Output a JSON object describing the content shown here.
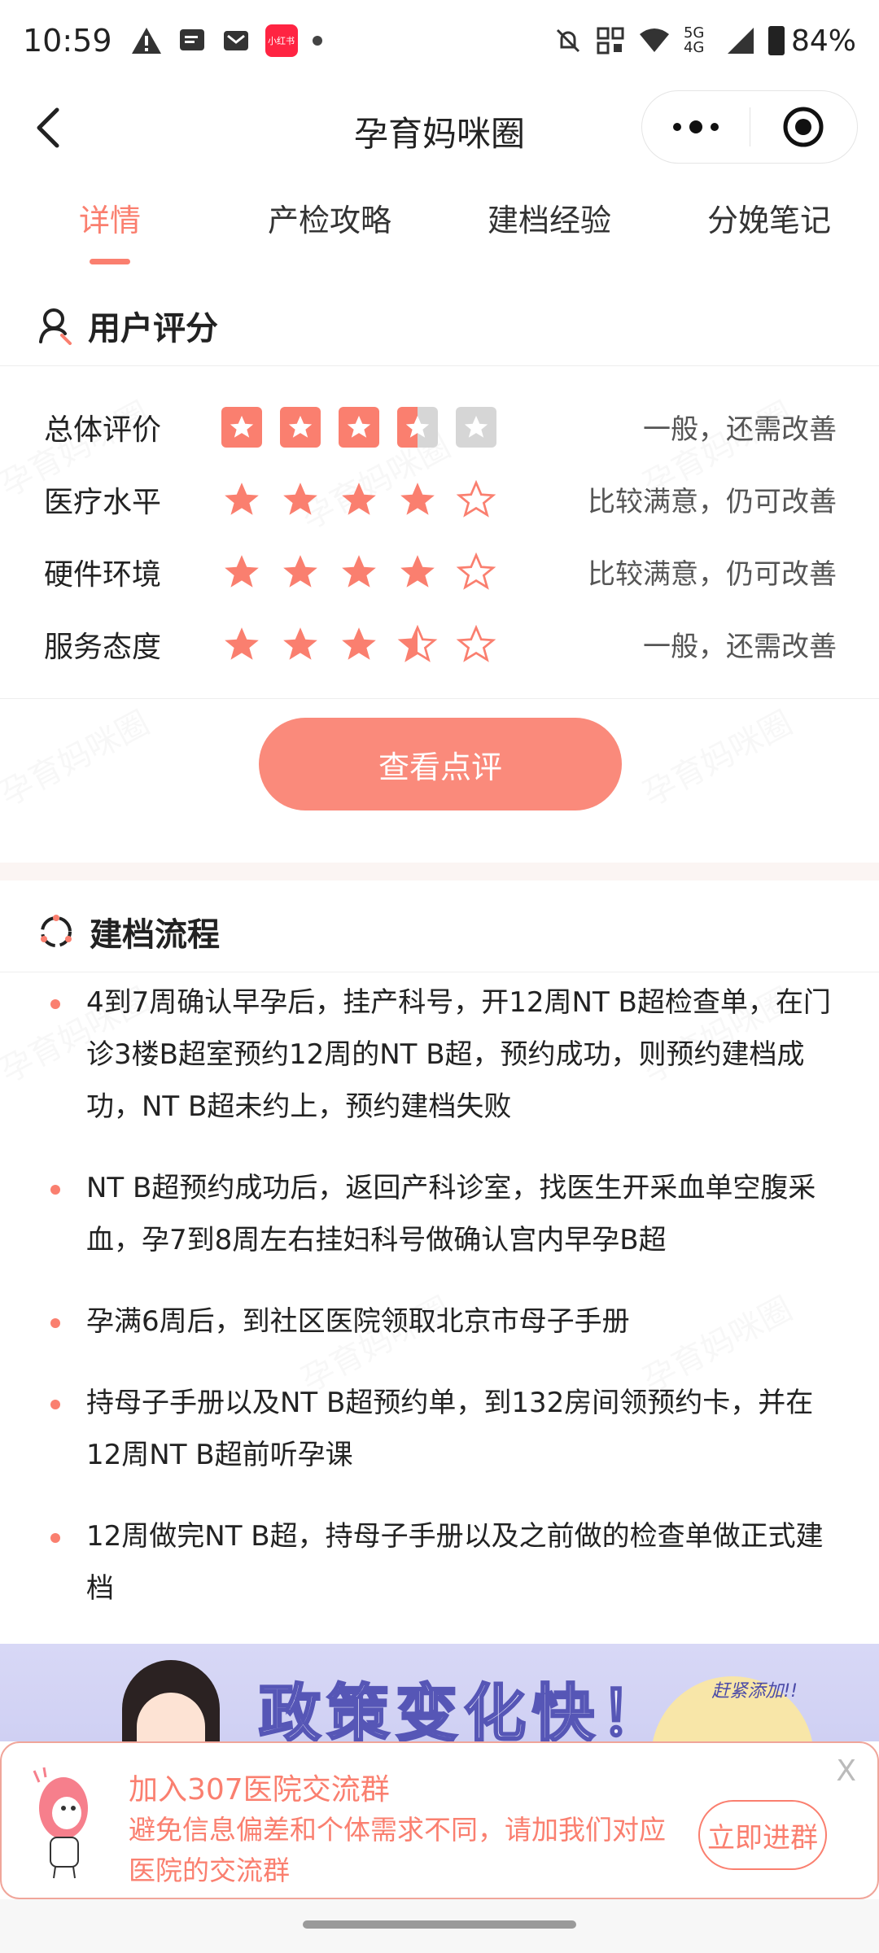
{
  "status_bar": {
    "time": "10:59",
    "app_badge": "小红书",
    "network": "5G 4G",
    "battery": "84%"
  },
  "nav": {
    "title": "孕育妈咪圈"
  },
  "tabs": [
    {
      "label": "详情",
      "active": true
    },
    {
      "label": "产检攻略",
      "active": false
    },
    {
      "label": "建档经验",
      "active": false
    },
    {
      "label": "分娩笔记",
      "active": false
    }
  ],
  "user_rating": {
    "title": "用户评分",
    "rows": [
      {
        "label": "总体评价",
        "score": 3.5,
        "comment": "一般，还需改善"
      },
      {
        "label": "医疗水平",
        "score": 4,
        "comment": "比较满意，仍可改善"
      },
      {
        "label": "硬件环境",
        "score": 4,
        "comment": "比较满意，仍可改善"
      },
      {
        "label": "服务态度",
        "score": 3.5,
        "comment": "一般，还需改善"
      }
    ],
    "view_button": "查看点评"
  },
  "process": {
    "title": "建档流程",
    "items": [
      "4到7周确认早孕后，挂产科号，开12周NT B超检查单，在门诊3楼B超室预约12周的NT B超，预约成功，则预约建档成功，NT B超未约上，预约建档失败",
      "NT B超预约成功后，返回产科诊室，找医生开采血单空腹采血，孕7到8周左右挂妇科号做确认宫内早孕B超",
      "孕满6周后，到社区医院领取北京市母子手册",
      "持母子手册以及NT B超预约单，到132房间领预约卡，并在12周NT B超前听孕课",
      "12周做完NT B超，持母子手册以及之前做的检查单做正式建档"
    ]
  },
  "banner": {
    "headline": "政策变化快！",
    "tag": "赶紧添加!!"
  },
  "popup": {
    "title": "加入307医院交流群",
    "description": "避免信息偏差和个体需求不同，请加我们对应医院的交流群",
    "join_button": "立即进群",
    "close": "X"
  },
  "watermark_text": "孕育妈咪圈",
  "colors": {
    "accent": "#fa7f6f",
    "star_off": "#d6d6d6",
    "banner_bg": "#d8d8f6"
  }
}
